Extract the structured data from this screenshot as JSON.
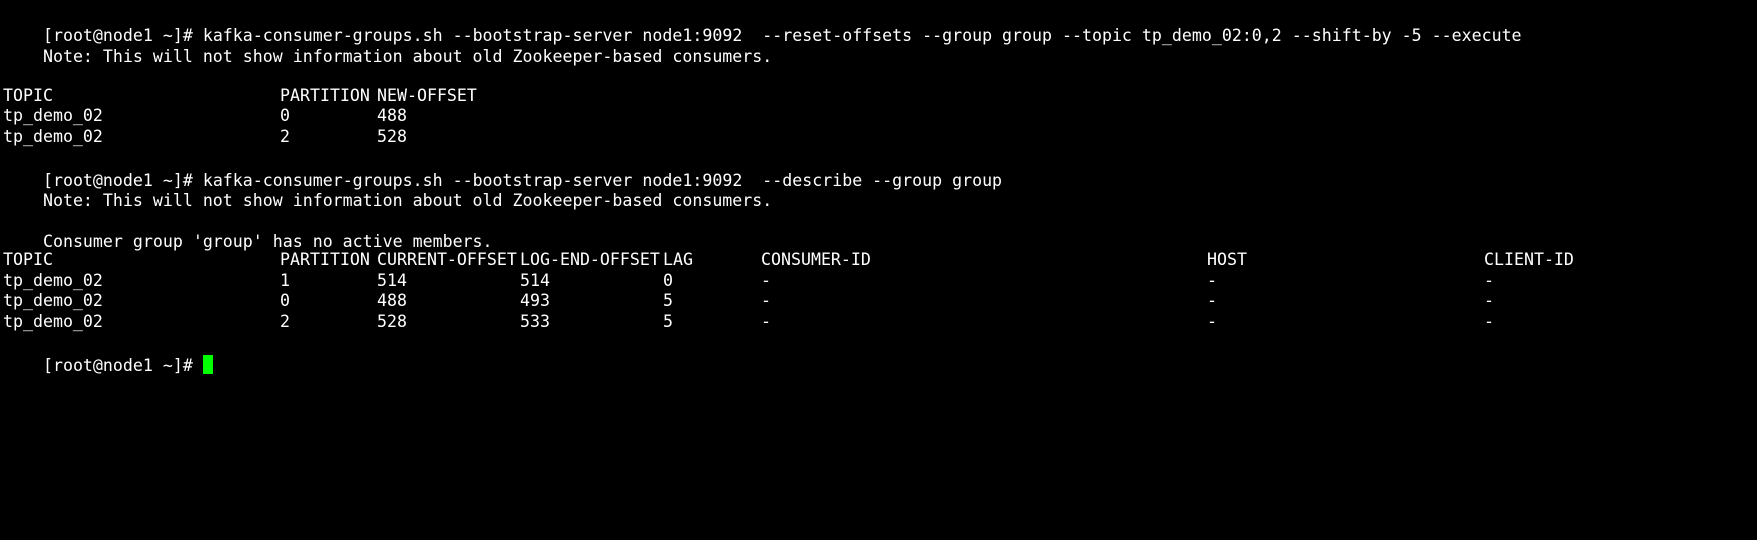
{
  "terminal": {
    "prompt": "[root@node1 ~]# ",
    "reset_command": "kafka-consumer-groups.sh --bootstrap-server node1:9092  --reset-offsets --group group --topic tp_demo_02:0,2 --shift-by -5 --execute",
    "note": "Note: This will not show information about old Zookeeper-based consumers.",
    "reset_table": {
      "headers": [
        "TOPIC",
        "PARTITION",
        "NEW-OFFSET"
      ],
      "rows": [
        [
          "tp_demo_02",
          "0",
          "488"
        ],
        [
          "tp_demo_02",
          "2",
          "528"
        ]
      ]
    },
    "describe_command": "kafka-consumer-groups.sh --bootstrap-server node1:9092  --describe --group group",
    "no_members_message": "Consumer group 'group' has no active members.",
    "describe_table": {
      "headers": [
        "TOPIC",
        "PARTITION",
        "CURRENT-OFFSET",
        "LOG-END-OFFSET",
        "LAG",
        "CONSUMER-ID",
        "HOST",
        "CLIENT-ID"
      ],
      "rows": [
        [
          "tp_demo_02",
          "1",
          "514",
          "514",
          "0",
          "-",
          "-",
          "-"
        ],
        [
          "tp_demo_02",
          "0",
          "488",
          "493",
          "5",
          "-",
          "-",
          "-"
        ],
        [
          "tp_demo_02",
          "2",
          "528",
          "533",
          "5",
          "-",
          "-",
          "-"
        ]
      ]
    },
    "colors": {
      "background": "#000000",
      "foreground": "#ffffff",
      "cursor": "#00ff00"
    }
  }
}
